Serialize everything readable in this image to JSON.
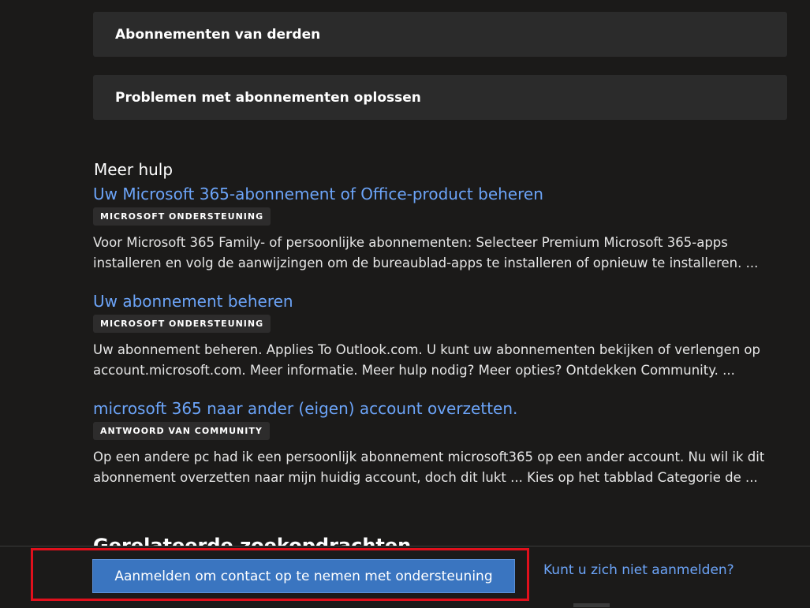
{
  "accordions": [
    {
      "label": "Abonnementen van derden"
    },
    {
      "label": "Problemen met abonnementen oplossen"
    }
  ],
  "more_help": {
    "title": "Meer hulp",
    "results": [
      {
        "title": "Uw Microsoft 365-abonnement of Office-product beheren",
        "badge": "MICROSOFT ONDERSTEUNING",
        "desc_line1": "Voor Microsoft 365 Family- of persoonlijke abonnementen: Selecteer Premium Microsoft 365-apps",
        "desc_line2": "installeren en volg de aanwijzingen om de bureaublad-apps te installeren of opnieuw te installeren. ..."
      },
      {
        "title": "Uw abonnement beheren",
        "badge": "MICROSOFT ONDERSTEUNING",
        "desc_line1": "Uw abonnement beheren. Applies To Outlook.com. U kunt uw abonnementen bekijken of verlengen op",
        "desc_line2": "account.microsoft.com. Meer informatie. Meer hulp nodig? Meer opties? Ontdekken Community. ..."
      },
      {
        "title": "microsoft 365 naar ander (eigen) account overzetten.",
        "badge": "ANTWOORD VAN COMMUNITY",
        "desc_line1": "Op een andere pc had ik een persoonlijk abonnement microsoft365 op een ander account. Nu wil ik dit",
        "desc_line2": "abonnement overzetten naar mijn huidig account, doch dit lukt ... Kies op het tabblad Categorie de ..."
      }
    ]
  },
  "related": {
    "title": "Gerelateerde zoekopdrachten"
  },
  "footer": {
    "signin_label": "Aanmelden om contact op te nemen met ondersteuning",
    "cant_signin_label": "Kunt u zich niet aanmelden?"
  },
  "colors": {
    "background": "#1b1a19",
    "link": "#6ca4f8",
    "button": "#3a75c0",
    "highlight": "#e0101c"
  }
}
